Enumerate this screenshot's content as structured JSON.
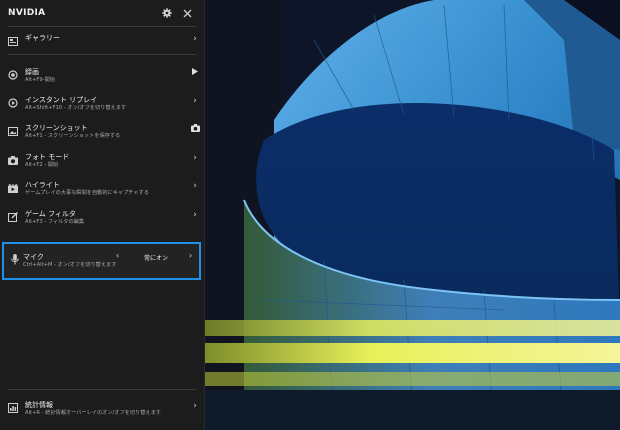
{
  "header": {
    "title": "NVIDIA",
    "icons": [
      "gear-icon",
      "close-icon"
    ]
  },
  "gallery": {
    "label": "ギャラリー",
    "icon": "gallery-icon"
  },
  "items": [
    {
      "title": "録画",
      "sub": "Alt+F9-開始",
      "icon": "record-icon",
      "action": "play-icon"
    },
    {
      "title": "インスタント リプレイ",
      "sub": "Alt+Shift+F10 - オン/オフを切り替えます",
      "icon": "replay-icon",
      "action": "chevron-right-icon"
    },
    {
      "title": "スクリーンショット",
      "sub": "Alt+F1 - スクリーンショットを保存する",
      "icon": "screenshot-icon",
      "action": "camera-icon"
    },
    {
      "title": "フォト モード",
      "sub": "Alt+F2 - 開始",
      "icon": "photo-mode-icon",
      "action": "chevron-right-icon"
    },
    {
      "title": "ハイライト",
      "sub": "ゲームプレイの大事な瞬間を自動的にキャプチャする",
      "icon": "highlights-icon",
      "action": "chevron-right-icon"
    },
    {
      "title": "ゲーム フィルタ",
      "sub": "Alt+F3 - フィルタの編集",
      "icon": "filter-icon",
      "action": "chevron-right-icon"
    }
  ],
  "mic": {
    "title": "マイク",
    "sub": "Ctrl+Alt+M - オン/オフを切り替えます",
    "value": "常にオン",
    "prev": "‹",
    "next": "›",
    "icon": "microphone-icon"
  },
  "stats": {
    "title": "統計情報",
    "sub": "Alt+R - 統計情報オーバーレイのオン/オフを切り替えます",
    "icon": "stats-icon"
  },
  "chevron": "›",
  "colors": {
    "panel": "#1c1c1c",
    "accent": "#1f8fe8",
    "building": "#2f86c8"
  }
}
